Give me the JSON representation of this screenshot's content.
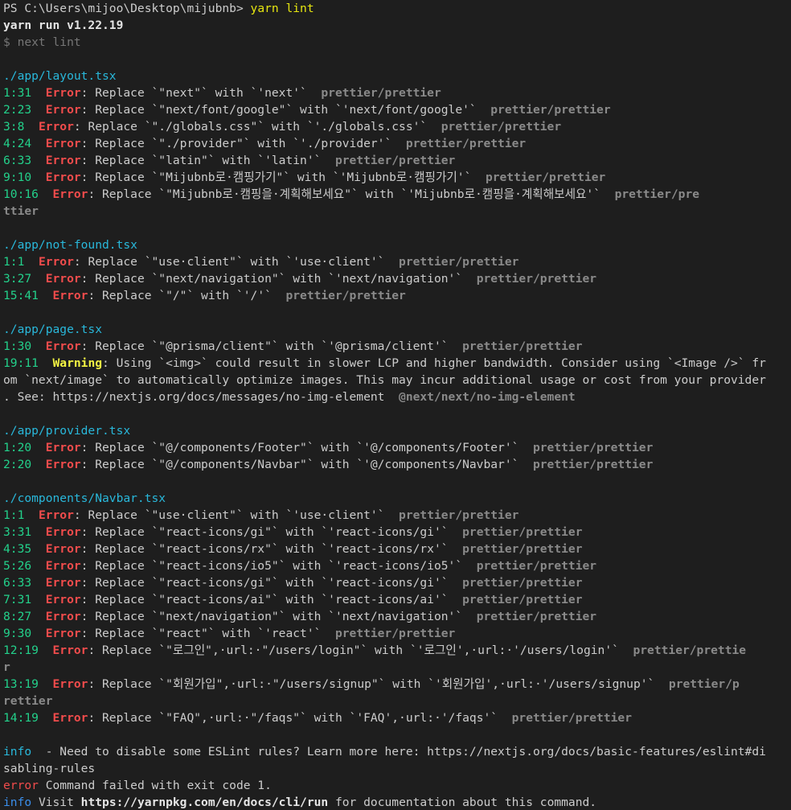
{
  "theme": {
    "background": "#1e1e1e",
    "text": "#cccccc",
    "command": "#e5e510",
    "file_path": "#29b8db",
    "location": "#23d18b",
    "error": "#f14c4c",
    "warning": "#f5f543",
    "rule": "#8a8a8a",
    "info": "#3b8eea"
  },
  "lines": [
    [
      {
        "t": "PS C:\\Users\\mijoo\\Desktop\\mijubnb> ",
        "c": "white"
      },
      {
        "t": "yarn lint",
        "c": "yellow"
      }
    ],
    [
      {
        "t": "yarn run v1.22.19",
        "c": "bold"
      }
    ],
    [
      {
        "t": "$ next lint",
        "c": "dim"
      }
    ],
    [],
    [
      {
        "t": "./app/layout.tsx",
        "c": "cyan"
      }
    ],
    [
      {
        "t": "1:31  ",
        "c": "green"
      },
      {
        "t": "Error",
        "c": "red"
      },
      {
        "t": ": Replace `\"next\"` with `'next'`  ",
        "c": "white"
      },
      {
        "t": "prettier/prettier",
        "c": "rule"
      }
    ],
    [
      {
        "t": "2:23  ",
        "c": "green"
      },
      {
        "t": "Error",
        "c": "red"
      },
      {
        "t": ": Replace `\"next/font/google\"` with `'next/font/google'`  ",
        "c": "white"
      },
      {
        "t": "prettier/prettier",
        "c": "rule"
      }
    ],
    [
      {
        "t": "3:8  ",
        "c": "green"
      },
      {
        "t": "Error",
        "c": "red"
      },
      {
        "t": ": Replace `\"./globals.css\"` with `'./globals.css'`  ",
        "c": "white"
      },
      {
        "t": "prettier/prettier",
        "c": "rule"
      }
    ],
    [
      {
        "t": "4:24  ",
        "c": "green"
      },
      {
        "t": "Error",
        "c": "red"
      },
      {
        "t": ": Replace `\"./provider\"` with `'./provider'`  ",
        "c": "white"
      },
      {
        "t": "prettier/prettier",
        "c": "rule"
      }
    ],
    [
      {
        "t": "6:33  ",
        "c": "green"
      },
      {
        "t": "Error",
        "c": "red"
      },
      {
        "t": ": Replace `\"latin\"` with `'latin'`  ",
        "c": "white"
      },
      {
        "t": "prettier/prettier",
        "c": "rule"
      }
    ],
    [
      {
        "t": "9:10  ",
        "c": "green"
      },
      {
        "t": "Error",
        "c": "red"
      },
      {
        "t": ": Replace `\"Mijubnb로·캠핑가기\"` with `'Mijubnb로·캠핑가기'`  ",
        "c": "white"
      },
      {
        "t": "prettier/prettier",
        "c": "rule"
      }
    ],
    [
      {
        "t": "10:16  ",
        "c": "green"
      },
      {
        "t": "Error",
        "c": "red"
      },
      {
        "t": ": Replace `\"Mijubnb로·캠핑을·계획해보세요\"` with `'Mijubnb로·캠핑을·계획해보세요'`  ",
        "c": "white"
      },
      {
        "t": "prettier/pre",
        "c": "rule"
      }
    ],
    [
      {
        "t": "ttier",
        "c": "rule"
      }
    ],
    [],
    [
      {
        "t": "./app/not-found.tsx",
        "c": "cyan"
      }
    ],
    [
      {
        "t": "1:1  ",
        "c": "green"
      },
      {
        "t": "Error",
        "c": "red"
      },
      {
        "t": ": Replace `\"use·client\"` with `'use·client'`  ",
        "c": "white"
      },
      {
        "t": "prettier/prettier",
        "c": "rule"
      }
    ],
    [
      {
        "t": "3:27  ",
        "c": "green"
      },
      {
        "t": "Error",
        "c": "red"
      },
      {
        "t": ": Replace `\"next/navigation\"` with `'next/navigation'`  ",
        "c": "white"
      },
      {
        "t": "prettier/prettier",
        "c": "rule"
      }
    ],
    [
      {
        "t": "15:41  ",
        "c": "green"
      },
      {
        "t": "Error",
        "c": "red"
      },
      {
        "t": ": Replace `\"/\"` with `'/'`  ",
        "c": "white"
      },
      {
        "t": "prettier/prettier",
        "c": "rule"
      }
    ],
    [],
    [
      {
        "t": "./app/page.tsx",
        "c": "cyan"
      }
    ],
    [
      {
        "t": "1:30  ",
        "c": "green"
      },
      {
        "t": "Error",
        "c": "red"
      },
      {
        "t": ": Replace `\"@prisma/client\"` with `'@prisma/client'`  ",
        "c": "white"
      },
      {
        "t": "prettier/prettier",
        "c": "rule"
      }
    ],
    [
      {
        "t": "19:11  ",
        "c": "green"
      },
      {
        "t": "Warning",
        "c": "warn"
      },
      {
        "t": ": Using `<img>` could result in slower LCP and higher bandwidth. Consider using `<Image />` fr",
        "c": "white"
      }
    ],
    [
      {
        "t": "om `next/image` to automatically optimize images. This may incur additional usage or cost from your provider",
        "c": "white"
      }
    ],
    [
      {
        "t": ". See: https://nextjs.org/docs/messages/no-img-element  ",
        "c": "white"
      },
      {
        "t": "@next/next/no-img-element",
        "c": "rule"
      }
    ],
    [],
    [
      {
        "t": "./app/provider.tsx",
        "c": "cyan"
      }
    ],
    [
      {
        "t": "1:20  ",
        "c": "green"
      },
      {
        "t": "Error",
        "c": "red"
      },
      {
        "t": ": Replace `\"@/components/Footer\"` with `'@/components/Footer'`  ",
        "c": "white"
      },
      {
        "t": "prettier/prettier",
        "c": "rule"
      }
    ],
    [
      {
        "t": "2:20  ",
        "c": "green"
      },
      {
        "t": "Error",
        "c": "red"
      },
      {
        "t": ": Replace `\"@/components/Navbar\"` with `'@/components/Navbar'`  ",
        "c": "white"
      },
      {
        "t": "prettier/prettier",
        "c": "rule"
      }
    ],
    [],
    [
      {
        "t": "./components/Navbar.tsx",
        "c": "cyan"
      }
    ],
    [
      {
        "t": "1:1  ",
        "c": "green"
      },
      {
        "t": "Error",
        "c": "red"
      },
      {
        "t": ": Replace `\"use·client\"` with `'use·client'`  ",
        "c": "white"
      },
      {
        "t": "prettier/prettier",
        "c": "rule"
      }
    ],
    [
      {
        "t": "3:31  ",
        "c": "green"
      },
      {
        "t": "Error",
        "c": "red"
      },
      {
        "t": ": Replace `\"react-icons/gi\"` with `'react-icons/gi'`  ",
        "c": "white"
      },
      {
        "t": "prettier/prettier",
        "c": "rule"
      }
    ],
    [
      {
        "t": "4:35  ",
        "c": "green"
      },
      {
        "t": "Error",
        "c": "red"
      },
      {
        "t": ": Replace `\"react-icons/rx\"` with `'react-icons/rx'`  ",
        "c": "white"
      },
      {
        "t": "prettier/prettier",
        "c": "rule"
      }
    ],
    [
      {
        "t": "5:26  ",
        "c": "green"
      },
      {
        "t": "Error",
        "c": "red"
      },
      {
        "t": ": Replace `\"react-icons/io5\"` with `'react-icons/io5'`  ",
        "c": "white"
      },
      {
        "t": "prettier/prettier",
        "c": "rule"
      }
    ],
    [
      {
        "t": "6:33  ",
        "c": "green"
      },
      {
        "t": "Error",
        "c": "red"
      },
      {
        "t": ": Replace `\"react-icons/gi\"` with `'react-icons/gi'`  ",
        "c": "white"
      },
      {
        "t": "prettier/prettier",
        "c": "rule"
      }
    ],
    [
      {
        "t": "7:31  ",
        "c": "green"
      },
      {
        "t": "Error",
        "c": "red"
      },
      {
        "t": ": Replace `\"react-icons/ai\"` with `'react-icons/ai'`  ",
        "c": "white"
      },
      {
        "t": "prettier/prettier",
        "c": "rule"
      }
    ],
    [
      {
        "t": "8:27  ",
        "c": "green"
      },
      {
        "t": "Error",
        "c": "red"
      },
      {
        "t": ": Replace `\"next/navigation\"` with `'next/navigation'`  ",
        "c": "white"
      },
      {
        "t": "prettier/prettier",
        "c": "rule"
      }
    ],
    [
      {
        "t": "9:30  ",
        "c": "green"
      },
      {
        "t": "Error",
        "c": "red"
      },
      {
        "t": ": Replace `\"react\"` with `'react'`  ",
        "c": "white"
      },
      {
        "t": "prettier/prettier",
        "c": "rule"
      }
    ],
    [
      {
        "t": "12:19  ",
        "c": "green"
      },
      {
        "t": "Error",
        "c": "red"
      },
      {
        "t": ": Replace `\"로그인\",·url:·\"/users/login\"` with `'로그인',·url:·'/users/login'`  ",
        "c": "white"
      },
      {
        "t": "prettier/prettie",
        "c": "rule"
      }
    ],
    [
      {
        "t": "r",
        "c": "rule"
      }
    ],
    [
      {
        "t": "13:19  ",
        "c": "green"
      },
      {
        "t": "Error",
        "c": "red"
      },
      {
        "t": ": Replace `\"회원가입\",·url:·\"/users/signup\"` with `'회원가입',·url:·'/users/signup'`  ",
        "c": "white"
      },
      {
        "t": "prettier/p",
        "c": "rule"
      }
    ],
    [
      {
        "t": "rettier",
        "c": "rule"
      }
    ],
    [
      {
        "t": "14:19  ",
        "c": "green"
      },
      {
        "t": "Error",
        "c": "red"
      },
      {
        "t": ": Replace `\"FAQ\",·url:·\"/faqs\"` with `'FAQ',·url:·'/faqs'`  ",
        "c": "white"
      },
      {
        "t": "prettier/prettier",
        "c": "rule"
      }
    ],
    [],
    [
      {
        "t": "info",
        "c": "cyan"
      },
      {
        "t": "  - Need to disable some ESLint rules? Learn more here: https://nextjs.org/docs/basic-features/eslint#di",
        "c": "white"
      }
    ],
    [
      {
        "t": "sabling-rules",
        "c": "white"
      }
    ],
    [
      {
        "t": "error",
        "c": "err-plain"
      },
      {
        "t": " Command failed with exit code 1.",
        "c": "white"
      }
    ],
    [
      {
        "t": "info",
        "c": "info"
      },
      {
        "t": " Visit ",
        "c": "white"
      },
      {
        "t": "https://yarnpkg.com/en/docs/cli/run",
        "c": "link"
      },
      {
        "t": " for documentation about this command.",
        "c": "white"
      }
    ]
  ]
}
